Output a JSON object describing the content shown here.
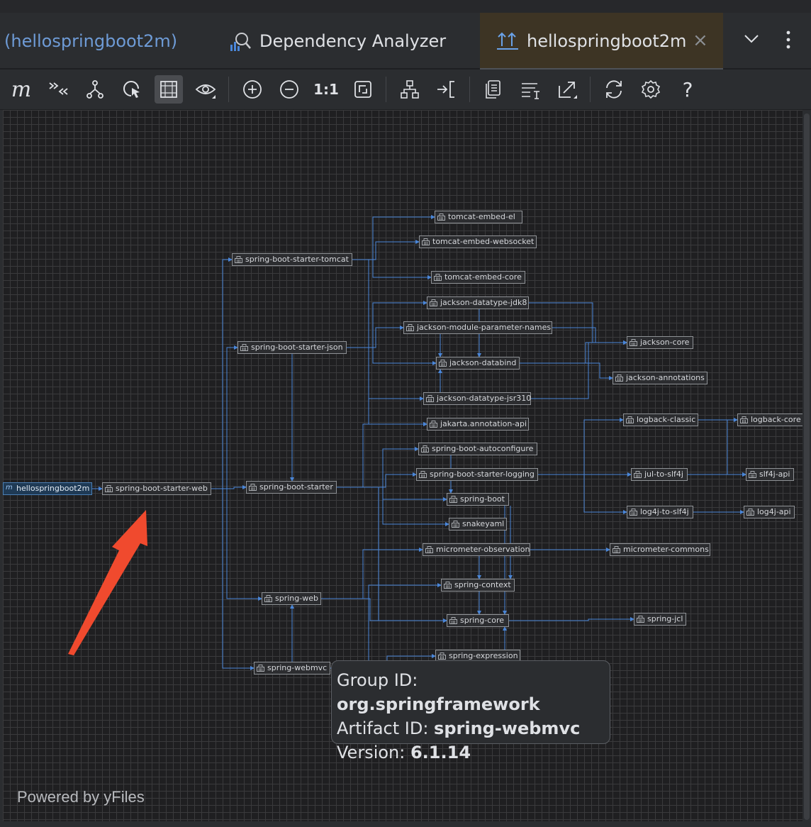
{
  "tabs": [
    {
      "label": "(hellospringboot2m)",
      "active": false
    },
    {
      "label": "Dependency Analyzer",
      "icon": "dependency-analyzer-icon",
      "active": false
    },
    {
      "label": "hellospringboot2m",
      "icon": "diagram-icon",
      "active": true,
      "close": "×"
    }
  ],
  "toolbar": {
    "zoom_reset_label": "1:1",
    "help_label": "?"
  },
  "graph": {
    "nodes": [
      {
        "id": "n-tomcat-embed-el",
        "label": "tomcat-embed-el"
      },
      {
        "id": "n-tomcat-embed-websocket",
        "label": "tomcat-embed-websocket"
      },
      {
        "id": "n-spring-boot-starter-tomcat",
        "label": "spring-boot-starter-tomcat"
      },
      {
        "id": "n-tomcat-embed-core",
        "label": "tomcat-embed-core"
      },
      {
        "id": "n-jackson-datatype-jdk8",
        "label": "jackson-datatype-jdk8"
      },
      {
        "id": "n-jackson-module-parameter-names",
        "label": "jackson-module-parameter-names"
      },
      {
        "id": "n-jackson-core",
        "label": "jackson-core"
      },
      {
        "id": "n-spring-boot-starter-json",
        "label": "spring-boot-starter-json"
      },
      {
        "id": "n-jackson-databind",
        "label": "jackson-databind"
      },
      {
        "id": "n-jackson-annotations",
        "label": "jackson-annotations"
      },
      {
        "id": "n-jackson-datatype-jsr310",
        "label": "jackson-datatype-jsr310"
      },
      {
        "id": "n-logback-classic",
        "label": "logback-classic"
      },
      {
        "id": "n-logback-core",
        "label": "logback-core"
      },
      {
        "id": "n-jakarta-annotation-api",
        "label": "jakarta.annotation-api"
      },
      {
        "id": "n-spring-boot-autoconfigure",
        "label": "spring-boot-autoconfigure"
      },
      {
        "id": "n-spring-boot-starter-logging",
        "label": "spring-boot-starter-logging"
      },
      {
        "id": "n-jul-to-slf4j",
        "label": "jul-to-slf4j"
      },
      {
        "id": "n-slf4j-api",
        "label": "slf4j-api"
      },
      {
        "id": "n-hellospringboot2m",
        "label": "hellospringboot2m"
      },
      {
        "id": "n-spring-boot-starter-web",
        "label": "spring-boot-starter-web"
      },
      {
        "id": "n-spring-boot-starter",
        "label": "spring-boot-starter"
      },
      {
        "id": "n-spring-boot",
        "label": "spring-boot"
      },
      {
        "id": "n-log4j-to-slf4j",
        "label": "log4j-to-slf4j"
      },
      {
        "id": "n-log4j-api",
        "label": "log4j-api"
      },
      {
        "id": "n-snakeyaml",
        "label": "snakeyaml"
      },
      {
        "id": "n-micrometer-observation",
        "label": "micrometer-observation"
      },
      {
        "id": "n-micrometer-commons",
        "label": "micrometer-commons"
      },
      {
        "id": "n-spring-context",
        "label": "spring-context"
      },
      {
        "id": "n-spring-web",
        "label": "spring-web"
      },
      {
        "id": "n-spring-core",
        "label": "spring-core"
      },
      {
        "id": "n-spring-jcl",
        "label": "spring-jcl"
      },
      {
        "id": "n-spring-expression",
        "label": "spring-expression"
      },
      {
        "id": "n-spring-webmvc",
        "label": "spring-webmvc"
      }
    ]
  },
  "tooltip": {
    "group_label": "Group ID:",
    "group_value": "org.springframework",
    "artifact_label": "Artifact ID:",
    "artifact_value": "spring-webmvc",
    "version_label": "Version:",
    "version_value": "6.1.14"
  },
  "footer": {
    "powered_by": "Powered by yFiles"
  },
  "colors": {
    "edge": "#4a86d8",
    "annotation_arrow": "#f04a2e",
    "active_tab": "#3d3424"
  }
}
